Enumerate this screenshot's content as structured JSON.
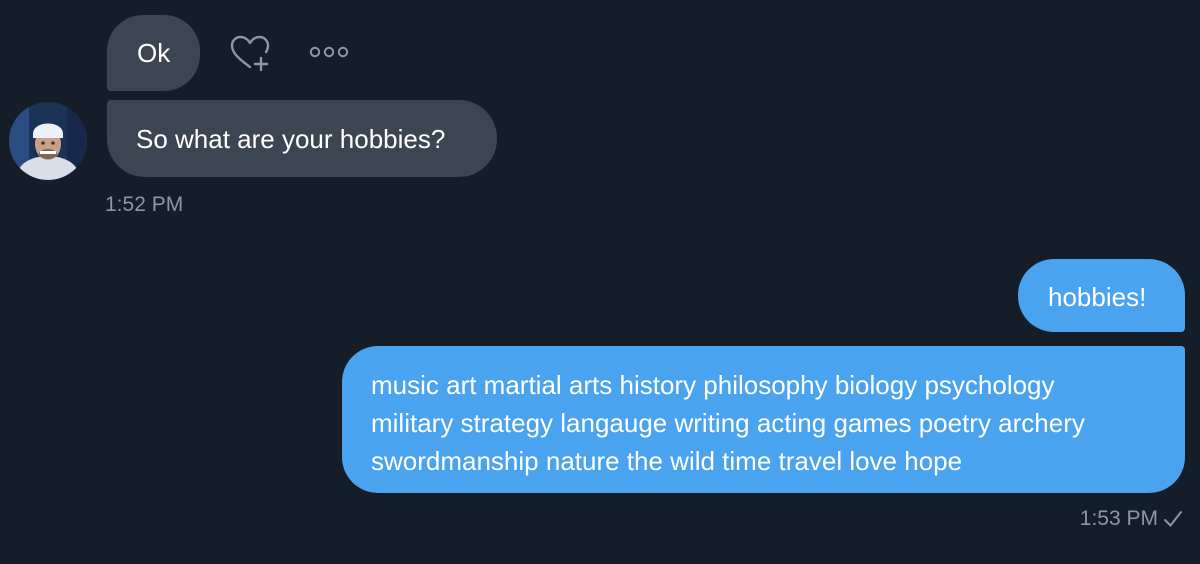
{
  "conversation": {
    "incoming": {
      "messages": [
        {
          "text": "Ok"
        },
        {
          "text": "So what are your hobbies?"
        }
      ],
      "timestamp": "1:52 PM",
      "actions": {
        "react_icon": "heart-plus-icon",
        "more_icon": "more-horizontal-icon"
      }
    },
    "outgoing": {
      "messages": [
        {
          "text": "hobbies!"
        },
        {
          "lines": [
            "music art martial arts history philosophy biology psychology",
            "military strategy langauge writing acting games poetry archery",
            "swordmanship nature the wild time travel love hope"
          ]
        }
      ],
      "timestamp": "1:53 PM",
      "status_icon": "check-icon"
    }
  },
  "colors": {
    "background": "#151d29",
    "incoming_bubble": "#3c4653",
    "outgoing_bubble": "#4aa3ee",
    "timestamp_text": "#8899a6"
  }
}
